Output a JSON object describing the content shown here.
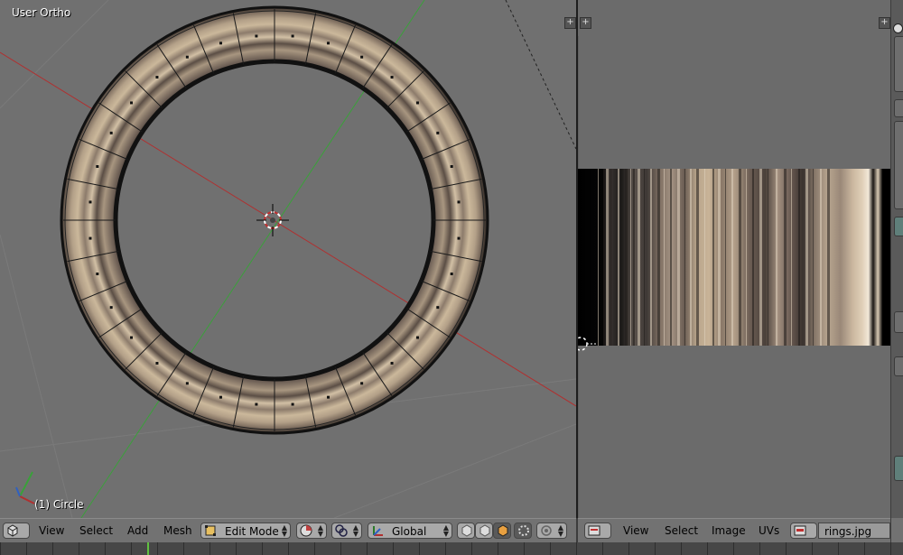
{
  "viewport3d": {
    "view_label": "User Ortho",
    "object_label": "(1) Circle"
  },
  "header3d": {
    "menus": [
      "View",
      "Select",
      "Add",
      "Mesh"
    ],
    "mode": "Edit Mode",
    "orientation": "Global"
  },
  "header_uv": {
    "menus": [
      "View",
      "Select",
      "Image",
      "UVs"
    ],
    "image_name": "rings.jpg"
  },
  "icons": {
    "editor_type": "cube-icon",
    "mode": "edit-mode-icon",
    "shading": "sphere-icon",
    "pivot": "pivot-icon",
    "manipulator": "manipulator-icon",
    "image_browse": "image-icon"
  },
  "colors": {
    "viewport_bg": "#707070",
    "x_axis": "#b03030",
    "y_axis": "#3aa03a",
    "ring_light": "#cdbba0",
    "ring_dark": "#5e5048"
  }
}
